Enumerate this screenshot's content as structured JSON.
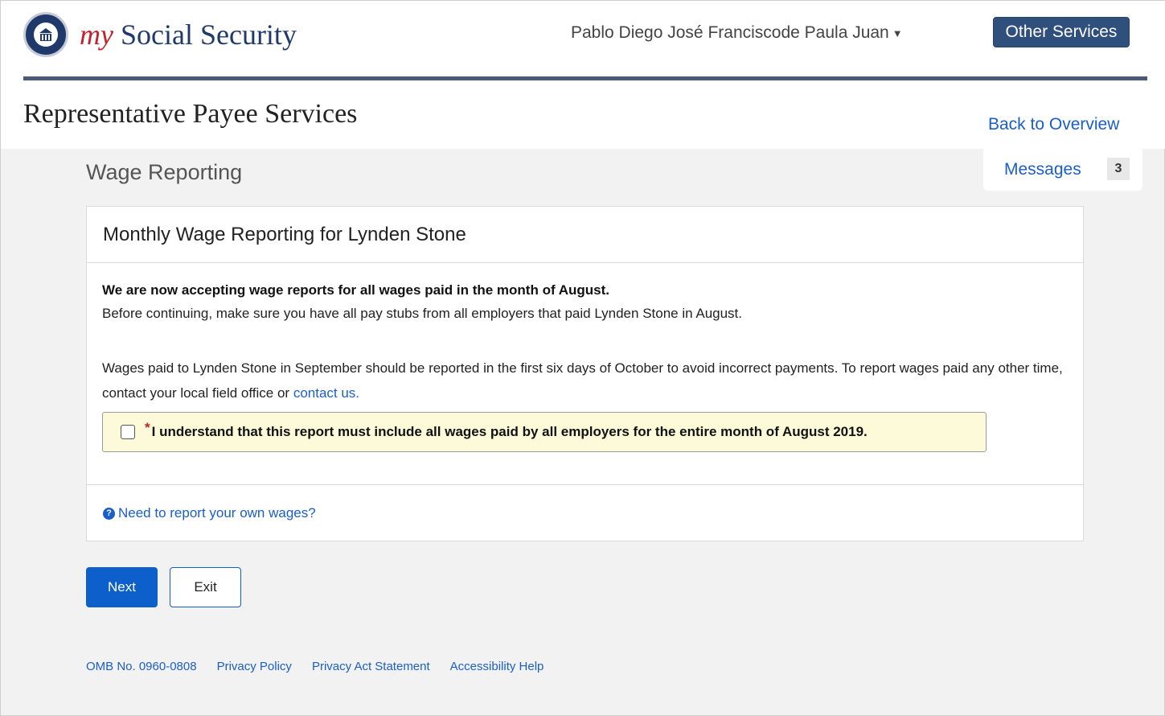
{
  "header": {
    "brand_my": "my",
    "brand_rest": "Social Security",
    "user_name": "Pablo Diego José Franciscode Paula Juan",
    "other_services": "Other Services"
  },
  "page": {
    "title": "Representative Payee Services",
    "back_link": "Back to Overview",
    "messages_label": "Messages",
    "messages_count": "3",
    "section_title": "Wage Reporting"
  },
  "panel": {
    "heading": "Monthly Wage Reporting for Lynden Stone",
    "bold_notice": "We are now accepting wage reports for all wages paid in the month of August.",
    "instruction": "Before continuing, make sure you have all pay stubs from all employers that paid Lynden Stone in August.",
    "info_text": "Wages paid to Lynden Stone in September should be reported in the first six days of October to avoid incorrect payments. To report wages paid any other time, contact your local field office or ",
    "contact_link": "contact us.",
    "required_marker": "*",
    "acknowledgement": "I understand that this report must include all wages paid by all employers for the entire month of August 2019.",
    "acknowledged": false,
    "own_wages_link": "Need to report your own wages?"
  },
  "actions": {
    "next": "Next",
    "exit": "Exit"
  },
  "footer": {
    "omb": "OMB No. 0960-0808",
    "privacy_policy": "Privacy Policy",
    "privacy_act": "Privacy Act Statement",
    "accessibility": "Accessibility Help"
  },
  "colors": {
    "brand_red": "#c2222b",
    "brand_navy": "#1f3a6a",
    "link_blue": "#1a5ec9",
    "primary_button": "#0d5fcc",
    "notice_background": "#fcfad8"
  }
}
